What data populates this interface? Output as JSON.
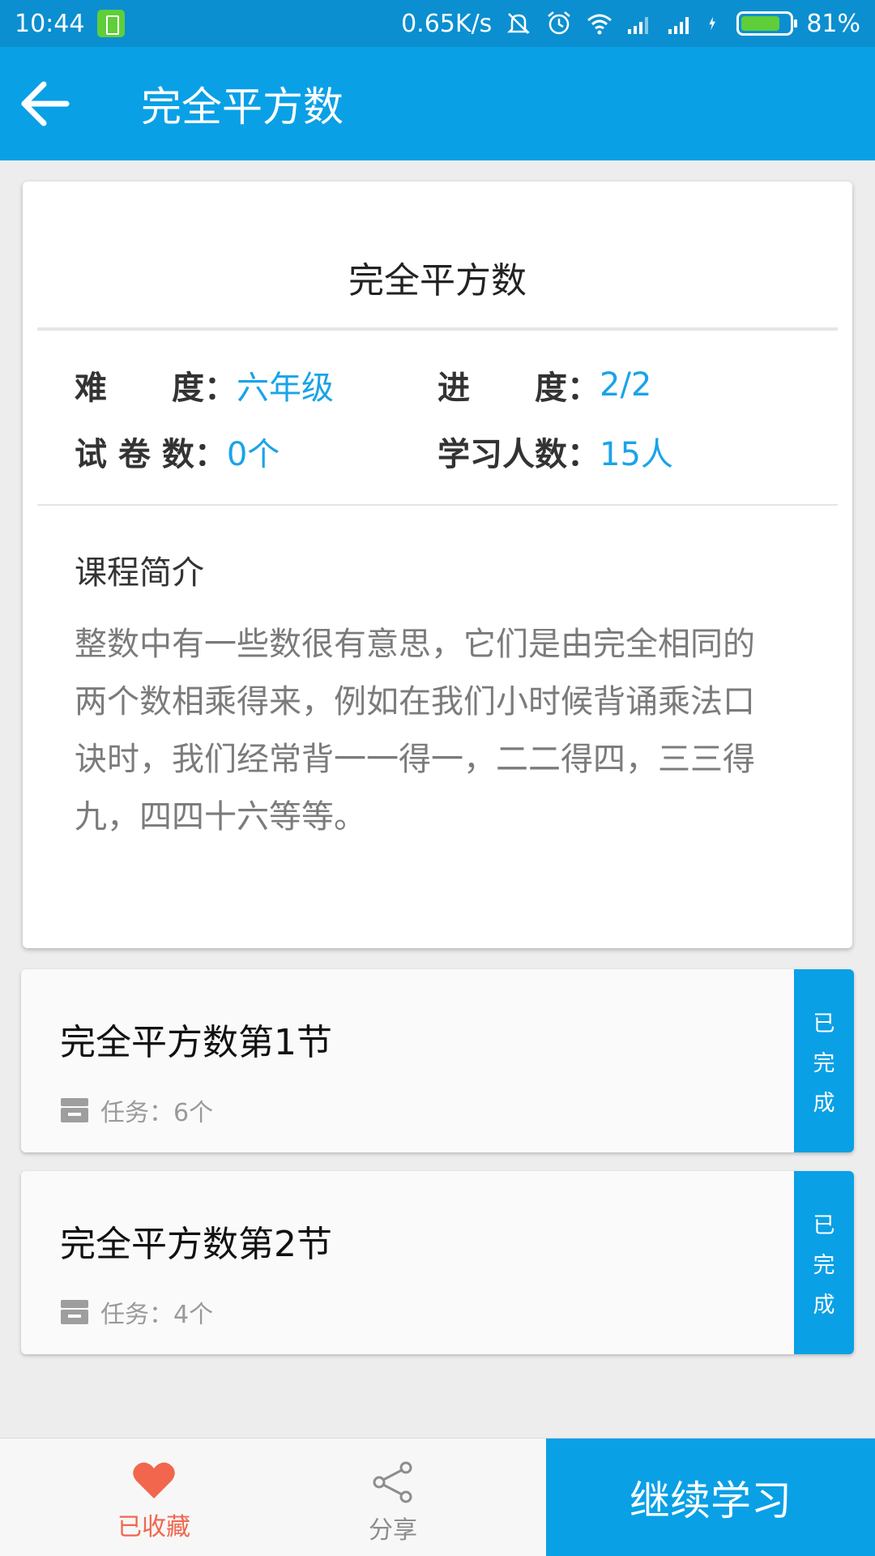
{
  "status_bar": {
    "time": "10:44",
    "network_speed": "0.65K/s",
    "battery_percent": "81%",
    "battery_level": 0.81,
    "icons": [
      "battery-saver-icon",
      "mute-icon",
      "alarm-icon",
      "wifi-icon",
      "signal-icon",
      "signal-icon",
      "charging-icon",
      "battery-icon"
    ]
  },
  "app_bar": {
    "title": "完全平方数",
    "back_icon": "arrow-left-icon"
  },
  "course": {
    "title": "完全平方数",
    "difficulty_label": "难　　度：",
    "difficulty_value": "六年级",
    "progress_label": "进　　度：",
    "progress_value": "2/2",
    "papers_label": "试 卷 数：",
    "papers_value": "0个",
    "learners_label": "学习人数：",
    "learners_value": "15人",
    "intro_heading": "课程简介",
    "intro_text": "整数中有一些数很有意思，它们是由完全相同的两个数相乘得来，例如在我们小时候背诵乘法口诀时，我们经常背一一得一，二二得四，三三得九，四四十六等等。"
  },
  "lessons": [
    {
      "name": "完全平方数第1节",
      "task": "任务：6个",
      "status": [
        "已",
        "完",
        "成"
      ]
    },
    {
      "name": "完全平方数第2节",
      "task": "任务：4个",
      "status": [
        "已",
        "完",
        "成"
      ]
    }
  ],
  "bottom_bar": {
    "favorite_label": "已收藏",
    "share_label": "分享",
    "continue_label": "继续学习"
  },
  "colors": {
    "primary": "#0aa0e6",
    "status_bar": "#0b8fd0",
    "favorite": "#f2664d",
    "value_text": "#1aa3ea"
  }
}
